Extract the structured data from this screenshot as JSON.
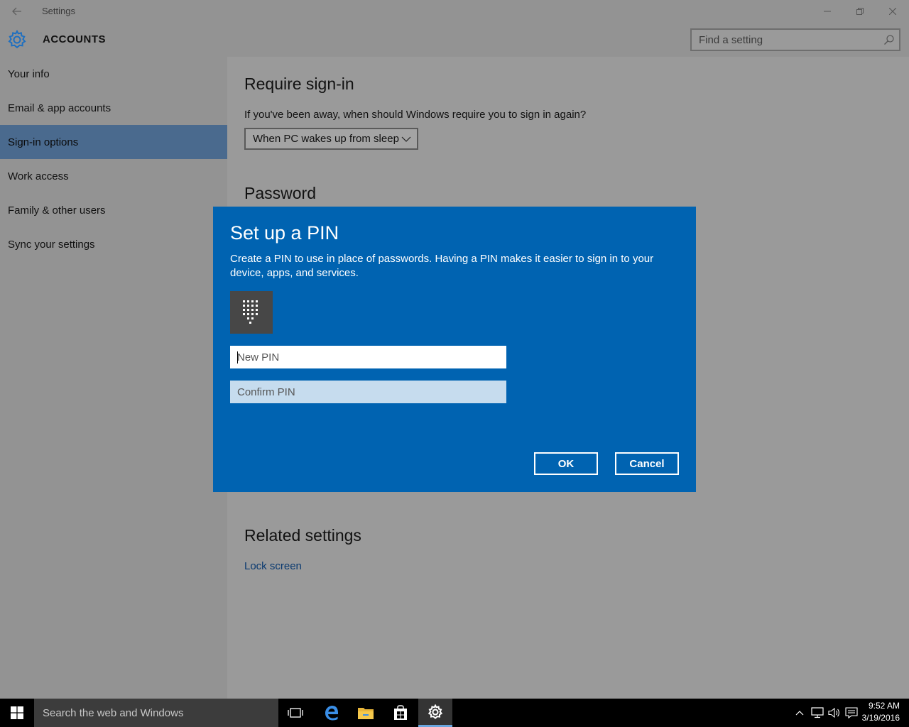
{
  "window": {
    "title": "Settings",
    "section_title": "ACCOUNTS",
    "search_placeholder": "Find a setting"
  },
  "sidebar": {
    "items": [
      {
        "label": "Your info"
      },
      {
        "label": "Email & app accounts"
      },
      {
        "label": "Sign-in options",
        "selected": true
      },
      {
        "label": "Work access"
      },
      {
        "label": "Family & other users"
      },
      {
        "label": "Sync your settings"
      }
    ]
  },
  "main": {
    "require_signin_heading": "Require sign-in",
    "require_signin_question": "If you've been away, when should Windows require you to sign in again?",
    "require_signin_selected": "When PC wakes up from sleep",
    "password_heading": "Password",
    "related_heading": "Related settings",
    "lock_screen_link": "Lock screen"
  },
  "dialog": {
    "title": "Set up a PIN",
    "description": "Create a PIN to use in place of passwords. Having a PIN makes it easier to sign in to your device, apps, and services.",
    "new_pin_placeholder": "New PIN",
    "new_pin_value": "",
    "confirm_pin_placeholder": "Confirm PIN",
    "confirm_pin_value": "",
    "ok_label": "OK",
    "cancel_label": "Cancel",
    "icon": "keypad-icon"
  },
  "taskbar": {
    "search_text": "Search the web and Windows",
    "time": "9:52 AM",
    "date": "3/19/2016",
    "pinned": [
      "task-view-icon",
      "edge-icon",
      "file-explorer-icon",
      "store-icon",
      "settings-icon"
    ],
    "active_app": "settings-icon"
  },
  "colors": {
    "dialog_bg": "#0063b1",
    "selected_nav": "#4a6a8e",
    "accent": "#1e7bd8",
    "link": "#0a3a70"
  }
}
